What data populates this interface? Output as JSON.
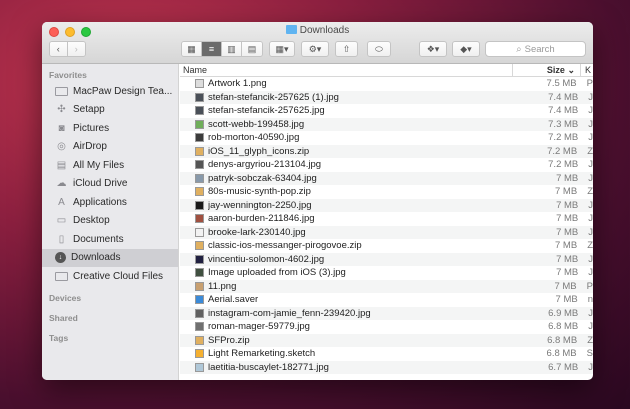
{
  "window": {
    "title": "Downloads"
  },
  "toolbar": {
    "search_placeholder": "Search"
  },
  "sidebar": {
    "favorites_header": "Favorites",
    "favorites": [
      {
        "label": "MacPaw Design Tea...",
        "icon": "folder-icon"
      },
      {
        "label": "Setapp",
        "icon": "setapp-icon"
      },
      {
        "label": "Pictures",
        "icon": "camera-icon"
      },
      {
        "label": "AirDrop",
        "icon": "airdrop-icon"
      },
      {
        "label": "All My Files",
        "icon": "files-icon"
      },
      {
        "label": "iCloud Drive",
        "icon": "cloud-icon"
      },
      {
        "label": "Applications",
        "icon": "applications-icon"
      },
      {
        "label": "Desktop",
        "icon": "desktop-icon"
      },
      {
        "label": "Documents",
        "icon": "documents-icon"
      },
      {
        "label": "Downloads",
        "icon": "downloads-icon"
      },
      {
        "label": "Creative Cloud Files",
        "icon": "folder-icon"
      }
    ],
    "devices_header": "Devices",
    "shared_header": "Shared",
    "tags_header": "Tags"
  },
  "columns": {
    "name": "Name",
    "size": "Size",
    "kind": "K"
  },
  "files": [
    {
      "name": "Artwork 1.png",
      "size": "7.5 MB",
      "kind": "P",
      "color": "#dddddd"
    },
    {
      "name": "stefan-stefancik-257625 (1).jpg",
      "size": "7.4 MB",
      "kind": "J",
      "color": "#4a5058"
    },
    {
      "name": "stefan-stefancik-257625.jpg",
      "size": "7.4 MB",
      "kind": "J",
      "color": "#4a5058"
    },
    {
      "name": "scott-webb-199458.jpg",
      "size": "7.3 MB",
      "kind": "J",
      "color": "#6fae5a"
    },
    {
      "name": "rob-morton-40590.jpg",
      "size": "7.2 MB",
      "kind": "J",
      "color": "#3b3b3b"
    },
    {
      "name": "iOS_11_glyph_icons.zip",
      "size": "7.2 MB",
      "kind": "Z",
      "color": "#e0b060"
    },
    {
      "name": "denys-argyriou-213104.jpg",
      "size": "7.2 MB",
      "kind": "J",
      "color": "#555555"
    },
    {
      "name": "patryk-sobczak-63404.jpg",
      "size": "7 MB",
      "kind": "J",
      "color": "#8899aa"
    },
    {
      "name": "80s-music-synth-pop.zip",
      "size": "7 MB",
      "kind": "Z",
      "color": "#e0b060"
    },
    {
      "name": "jay-wennington-2250.jpg",
      "size": "7 MB",
      "kind": "J",
      "color": "#1a1a1a"
    },
    {
      "name": "aaron-burden-211846.jpg",
      "size": "7 MB",
      "kind": "J",
      "color": "#a05040"
    },
    {
      "name": "brooke-lark-230140.jpg",
      "size": "7 MB",
      "kind": "J",
      "color": "#f2f2f2"
    },
    {
      "name": "classic-ios-messanger-pirogovoe.zip",
      "size": "7 MB",
      "kind": "Z",
      "color": "#e0b060"
    },
    {
      "name": "vincentiu-solomon-4602.jpg",
      "size": "7 MB",
      "kind": "J",
      "color": "#202040"
    },
    {
      "name": "Image uploaded from iOS (3).jpg",
      "size": "7 MB",
      "kind": "J",
      "color": "#405040"
    },
    {
      "name": "11.png",
      "size": "7 MB",
      "kind": "P",
      "color": "#c8a070"
    },
    {
      "name": "Aerial.saver",
      "size": "7 MB",
      "kind": "n",
      "color": "#3a8ad8"
    },
    {
      "name": "instagram-com-jamie_fenn-239420.jpg",
      "size": "6.9 MB",
      "kind": "J",
      "color": "#606060"
    },
    {
      "name": "roman-mager-59779.jpg",
      "size": "6.8 MB",
      "kind": "J",
      "color": "#707070"
    },
    {
      "name": "SFPro.zip",
      "size": "6.8 MB",
      "kind": "Z",
      "color": "#e0b060"
    },
    {
      "name": "Light Remarketing.sketch",
      "size": "6.8 MB",
      "kind": "S",
      "color": "#f5b030"
    },
    {
      "name": "laetitia-buscaylet-182771.jpg",
      "size": "6.7 MB",
      "kind": "J",
      "color": "#b0c8d8"
    }
  ]
}
